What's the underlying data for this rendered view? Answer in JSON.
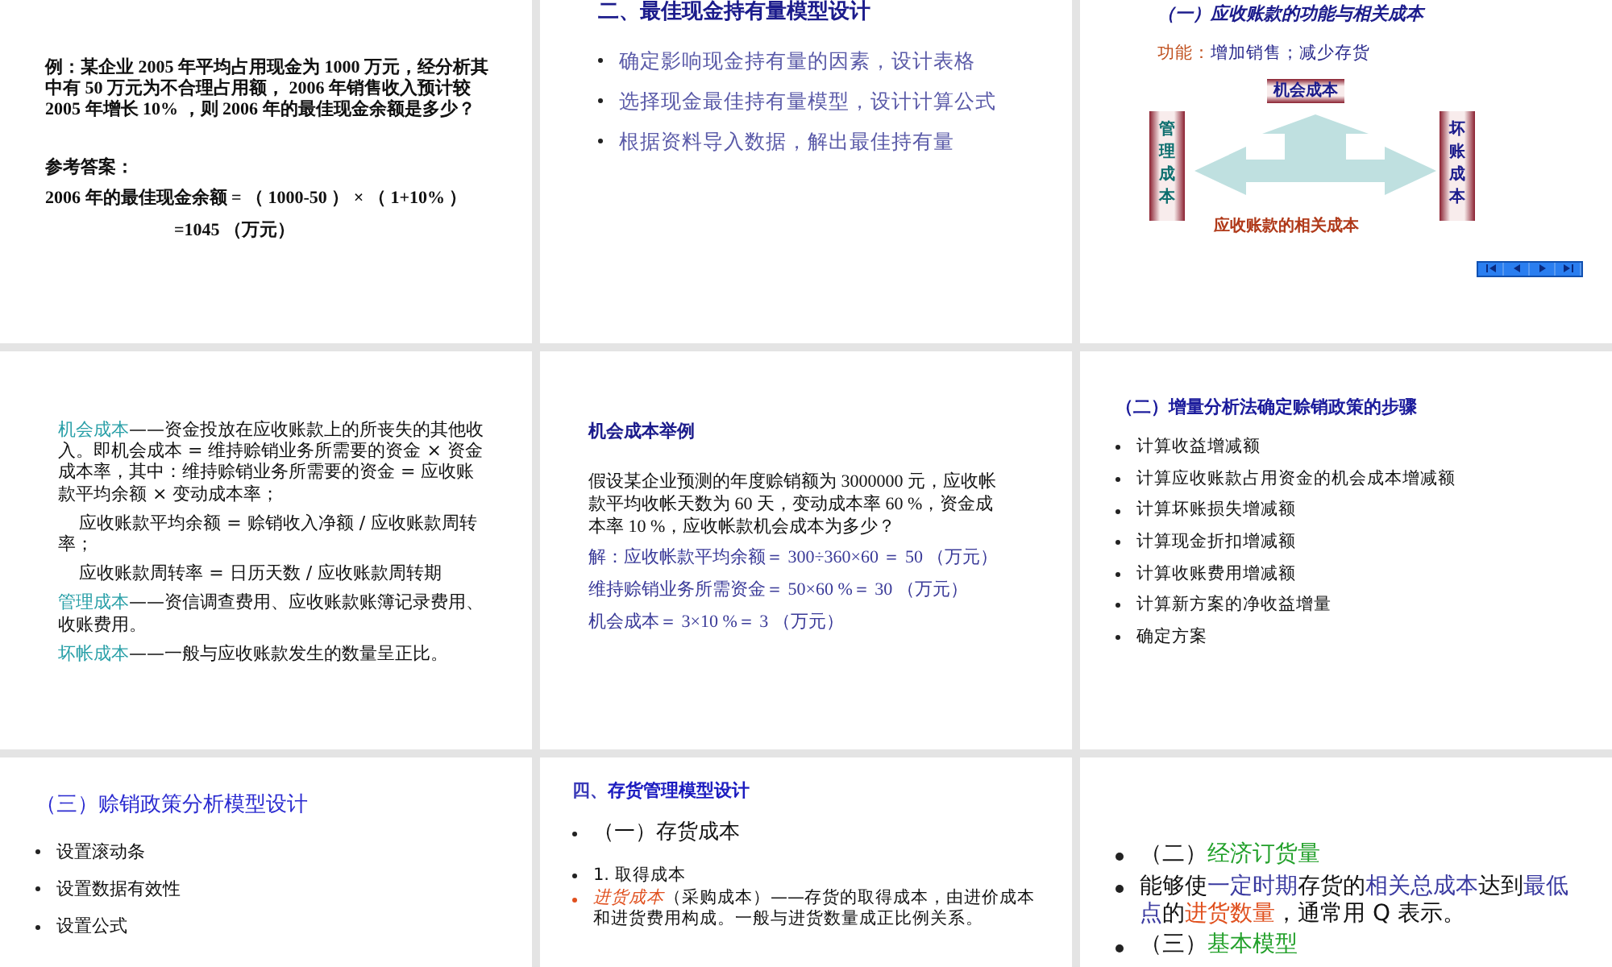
{
  "slides": [
    {
      "blocks": [
        {
          "kind": "text",
          "bold": true,
          "segments": [
            {
              "text": "例：某企业 2005 年平均占用现金为 1000 万元，经分析其中有 50 万元为不合理占用额， 2006 年销售收入预计较 2005 年增长 10% ，则 2006 年的最佳现金余额是多少？",
              "color": "#111111"
            }
          ]
        },
        {
          "kind": "answer",
          "bold": true,
          "segments": [
            {
              "text": "参考答案：",
              "color": "#111111"
            }
          ]
        },
        {
          "kind": "answer",
          "bold": true,
          "segments": [
            {
              "text": "2006 年的最佳现金余额 = （ 1000-50 ） × （ 1+10% ）",
              "color": "#111111"
            }
          ]
        },
        {
          "kind": "result",
          "bold": true,
          "segments": [
            {
              "text": "=1045 （万元）",
              "color": "#111111"
            }
          ]
        }
      ]
    },
    {
      "blocks": [
        {
          "kind": "title",
          "bold": true,
          "segments": [
            {
              "text": "二、最佳现金持有量模型设计",
              "color": "#1c1c8c"
            }
          ]
        },
        {
          "kind": "bullet",
          "bold": false,
          "segments": [
            {
              "text": "确定影响现金持有量的因素，设计表格",
              "color": "#5a5aa8"
            }
          ]
        },
        {
          "kind": "bullet",
          "bold": false,
          "segments": [
            {
              "text": "选择现金最佳持有量模型，设计计算公式",
              "color": "#5a5aa8"
            }
          ]
        },
        {
          "kind": "bullet",
          "bold": false,
          "segments": [
            {
              "text": "根据资料导入数据，解出最佳持有量",
              "color": "#5a5aa8"
            }
          ]
        }
      ]
    },
    {
      "blocks": [
        {
          "kind": "heading",
          "bold": true,
          "segments": [
            {
              "text": "（一）应收账款的功能与相关成本",
              "color": "#1c1c8c",
              "italic": true
            }
          ]
        },
        {
          "kind": "text",
          "bold": false,
          "segments": [
            {
              "text": "功能：",
              "color": "#c0501e"
            },
            {
              "text": "增加销售；减少存货",
              "color": "#2a2a8c"
            }
          ]
        },
        {
          "kind": "diagram",
          "top": "机会成本",
          "left": "管理成本",
          "right": "坏账成本",
          "caption": "应收账款的相关成本"
        },
        {
          "kind": "nav"
        }
      ]
    },
    {
      "blocks": [
        {
          "kind": "text",
          "bold": false,
          "segments": [
            {
              "text": "机会成本",
              "color": "#2aa0a8"
            },
            {
              "text": "——资金投放在应收账款上的所丧失的其他收入。即机会成本 = 维持赊销业务所需要的资金 × 资金成本率，其中：维持赊销业务所需要的资金 = 应收账款平均余额 × 变动成本率；",
              "color": "#111111"
            }
          ]
        },
        {
          "kind": "indent",
          "bold": false,
          "segments": [
            {
              "text": "应收账款平均余额 = 赊销收入净额 / 应收账款周转率；",
              "color": "#111111"
            }
          ]
        },
        {
          "kind": "indent",
          "bold": false,
          "segments": [
            {
              "text": "应收账款周转率 = 日历天数 / 应收账款周转期",
              "color": "#111111"
            }
          ]
        },
        {
          "kind": "text",
          "bold": false,
          "segments": [
            {
              "text": "管理成本",
              "color": "#2aa0a8"
            },
            {
              "text": "——资信调查费用、应收账款账簿记录费用、收账费用。",
              "color": "#111111"
            }
          ]
        },
        {
          "kind": "text",
          "bold": false,
          "segments": [
            {
              "text": "坏帐成本",
              "color": "#2aa0a8"
            },
            {
              "text": "——一般与应收账款发生的数量呈正比。",
              "color": "#111111"
            }
          ]
        }
      ]
    },
    {
      "blocks": [
        {
          "kind": "heading",
          "bold": true,
          "segments": [
            {
              "text": "机会成本举例",
              "color": "#1c1c8c"
            }
          ]
        },
        {
          "kind": "answer",
          "bold": false,
          "segments": [
            {
              "text": "假设某企业预测的年度赊销额为 3000000 元，应收帐款平均收帐天数为 60 天，变动成本率 60 %，资金成本率 10 %，应收帐款机会成本为多少？",
              "color": "#111111"
            }
          ]
        },
        {
          "kind": "answer",
          "bold": false,
          "segments": [
            {
              "text": "解：应收帐款平均余额＝ 300÷360×60 ＝ 50 （万元）",
              "color": "#3a3a98"
            }
          ]
        },
        {
          "kind": "answer",
          "bold": false,
          "segments": [
            {
              "text": "维持赊销业务所需资金＝ 50×60 %＝ 30 （万元）",
              "color": "#3a3a98"
            }
          ]
        },
        {
          "kind": "answer",
          "bold": false,
          "segments": [
            {
              "text": "机会成本＝ 3×10 %＝ 3 （万元）",
              "color": "#3a3a98"
            }
          ]
        }
      ]
    },
    {
      "blocks": [
        {
          "kind": "heading",
          "bold": true,
          "segments": [
            {
              "text": "（二）增量分析法确定赊销政策的步骤",
              "color": "#1c1c9c"
            }
          ]
        },
        {
          "kind": "bullet",
          "bold": false,
          "segments": [
            {
              "text": "计算收益增减额",
              "color": "#111111"
            }
          ]
        },
        {
          "kind": "bullet",
          "bold": false,
          "segments": [
            {
              "text": "计算应收账款占用资金的机会成本增减额",
              "color": "#111111"
            }
          ]
        },
        {
          "kind": "bullet",
          "bold": false,
          "segments": [
            {
              "text": "计算坏账损失增减额",
              "color": "#111111"
            }
          ]
        },
        {
          "kind": "bullet",
          "bold": false,
          "segments": [
            {
              "text": "计算现金折扣增减额",
              "color": "#111111"
            }
          ]
        },
        {
          "kind": "bullet",
          "bold": false,
          "segments": [
            {
              "text": "计算收账费用增减额",
              "color": "#111111"
            }
          ]
        },
        {
          "kind": "bullet",
          "bold": false,
          "segments": [
            {
              "text": "计算新方案的净收益增量",
              "color": "#111111"
            }
          ]
        },
        {
          "kind": "bullet",
          "bold": false,
          "segments": [
            {
              "text": "确定方案",
              "color": "#111111"
            }
          ]
        }
      ]
    },
    {
      "blocks": [
        {
          "kind": "title",
          "bold": false,
          "segments": [
            {
              "text": "（三）赊销政策分析模型设计",
              "color": "#2a2ad0"
            }
          ]
        },
        {
          "kind": "bullet",
          "bold": false,
          "segments": [
            {
              "text": "设置滚动条",
              "color": "#111111"
            }
          ]
        },
        {
          "kind": "bullet",
          "bold": false,
          "segments": [
            {
              "text": "设置数据有效性",
              "color": "#111111"
            }
          ]
        },
        {
          "kind": "bullet",
          "bold": false,
          "segments": [
            {
              "text": "设置公式",
              "color": "#111111"
            }
          ]
        }
      ]
    },
    {
      "blocks": [
        {
          "kind": "heading",
          "bold": true,
          "segments": [
            {
              "text": "四、",
              "color": "#3a3ab8"
            },
            {
              "text": "存货管理模型设计",
              "color": "#1c1cc0"
            }
          ]
        },
        {
          "kind": "big-bullet",
          "bold": false,
          "segments": [
            {
              "text": "（一）存货成本",
              "color": "#111111"
            }
          ]
        },
        {
          "kind": "bullet",
          "bold": false,
          "segments": [
            {
              "text": "1. 取得成本",
              "color": "#111111"
            }
          ]
        },
        {
          "kind": "bullet",
          "bold": false,
          "segments": [
            {
              "text": "进货成本",
              "color": "#e0501e",
              "italic": true
            },
            {
              "text": "（采购成本）——存货的取得成本，由进价成本和进货费用构成。一般与进货数量成正比例关系。",
              "color": "#111111"
            }
          ]
        }
      ]
    },
    {
      "blocks": [
        {
          "kind": "big-bullet",
          "bold": false,
          "segments": [
            {
              "text": "（二）",
              "color": "#111111"
            },
            {
              "text": "经济订货量",
              "color": "#22a02a"
            }
          ]
        },
        {
          "kind": "big-bullet",
          "bold": false,
          "segments": [
            {
              "text": "能够使",
              "color": "#111111"
            },
            {
              "text": "一定时期",
              "color": "#3a3aa0"
            },
            {
              "text": "存货的",
              "color": "#111111"
            },
            {
              "text": "相关总成本",
              "color": "#3a3aa0"
            },
            {
              "text": "达到",
              "color": "#111111"
            },
            {
              "text": "最低点",
              "color": "#3a3aa0"
            },
            {
              "text": "的",
              "color": "#111111"
            },
            {
              "text": "进货数量",
              "color": "#e0501e"
            },
            {
              "text": "，通常用 Q 表示。",
              "color": "#111111"
            }
          ]
        },
        {
          "kind": "big-bullet",
          "bold": false,
          "segments": [
            {
              "text": "（三）",
              "color": "#111111"
            },
            {
              "text": "基本模型",
              "color": "#22a02a"
            }
          ]
        }
      ]
    }
  ]
}
